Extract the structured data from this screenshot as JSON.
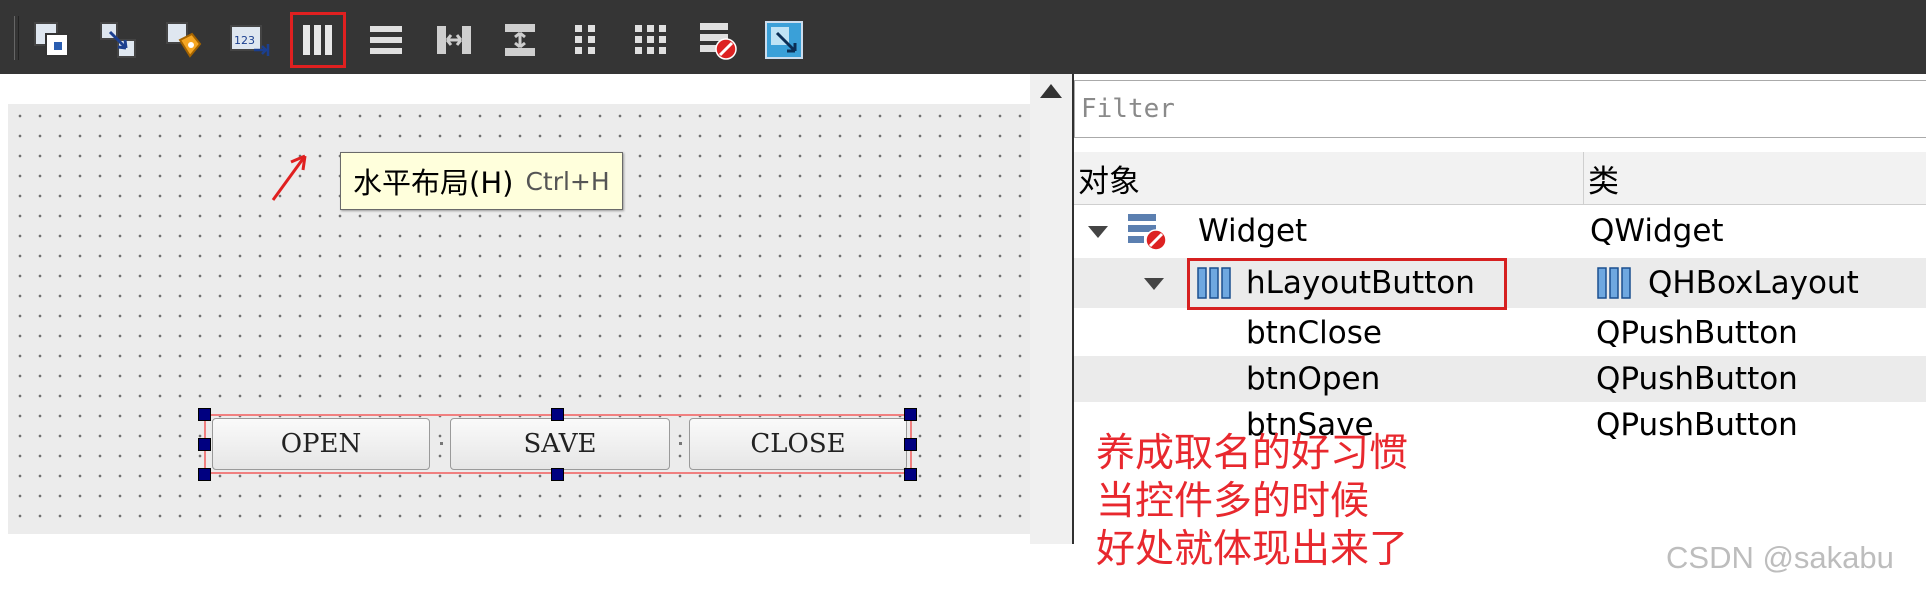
{
  "toolbar": {
    "icons": [
      "edit-widgets-icon",
      "edit-signals-slots-icon",
      "edit-buddies-icon",
      "edit-tab-order-icon",
      "horizontal-layout-icon",
      "vertical-layout-icon",
      "horizontal-splitter-icon",
      "vertical-splitter-icon",
      "form-layout-icon",
      "grid-layout-icon",
      "break-layout-icon",
      "adjust-size-icon"
    ],
    "active_icon": "horizontal-layout-icon",
    "accent": "#e02020"
  },
  "tooltip": {
    "label": "水平布局(H)",
    "shortcut": "Ctrl+H"
  },
  "canvas": {
    "buttons": [
      "OPEN",
      "SAVE",
      "CLOSE"
    ]
  },
  "inspector": {
    "filter_placeholder": "Filter",
    "columns": [
      "对象",
      "类"
    ],
    "rows": [
      {
        "object": "Widget",
        "class": "QWidget"
      },
      {
        "object": "hLayoutButton",
        "class": "QHBoxLayout"
      },
      {
        "object": "btnClose",
        "class": "QPushButton"
      },
      {
        "object": "btnOpen",
        "class": "QPushButton"
      },
      {
        "object": "btnSave",
        "class": "QPushButton"
      }
    ]
  },
  "note": {
    "lines": [
      "养成取名的好习惯",
      "当控件多的时候",
      "好处就体现出来了"
    ],
    "color": "#e8282e"
  },
  "watermark": "CSDN @sakabu"
}
